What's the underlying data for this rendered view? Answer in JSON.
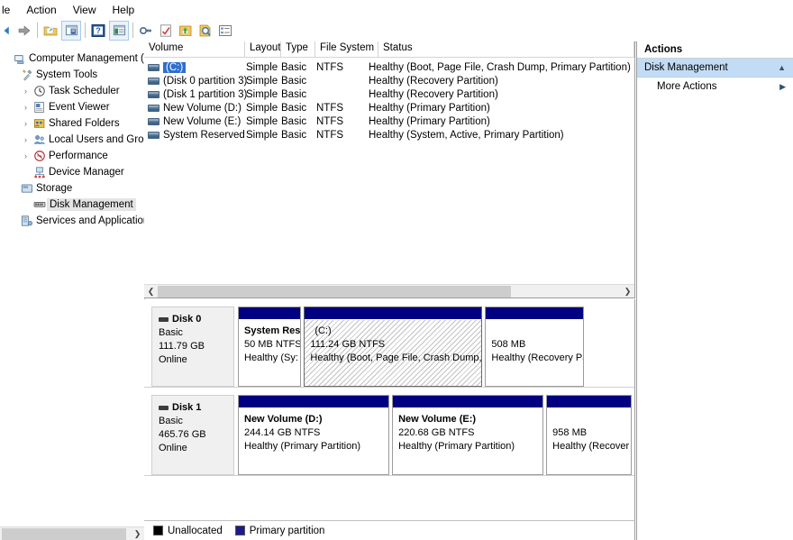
{
  "menubar": {
    "items": [
      {
        "label": "le"
      },
      {
        "label": "Action"
      },
      {
        "label": "View"
      },
      {
        "label": "Help"
      }
    ]
  },
  "toolbar": {
    "buttons": [
      {
        "name": "back-arrow-icon",
        "title": "Back"
      },
      {
        "name": "forward-arrow-icon",
        "title": "Forward"
      },
      {
        "name": "up-folder-icon",
        "title": "Up One Level"
      },
      {
        "name": "show-hide-console-tree-icon",
        "title": "Show/Hide Console Tree"
      },
      {
        "name": "help-icon",
        "title": "Help"
      },
      {
        "name": "properties-icon",
        "title": "Properties"
      },
      {
        "name": "rescan-disks-icon",
        "title": "Rescan Disks"
      },
      {
        "name": "refresh-icon",
        "title": "Refresh"
      },
      {
        "name": "export-list-icon",
        "title": "Export List"
      },
      {
        "name": "zoom-icon",
        "title": "Zoom"
      },
      {
        "name": "list-view-icon",
        "title": "View"
      }
    ]
  },
  "tree": {
    "items": [
      {
        "label": "Computer Management (Local",
        "icon": "computer-icon",
        "indent": 0,
        "expander": "",
        "selected": false
      },
      {
        "label": "System Tools",
        "icon": "tools-icon",
        "indent": 1,
        "expander": "",
        "selected": false
      },
      {
        "label": "Task Scheduler",
        "icon": "clock-icon",
        "indent": 2,
        "expander": "›",
        "selected": false
      },
      {
        "label": "Event Viewer",
        "icon": "event-viewer-icon",
        "indent": 2,
        "expander": "›",
        "selected": false
      },
      {
        "label": "Shared Folders",
        "icon": "shared-folders-icon",
        "indent": 2,
        "expander": "›",
        "selected": false
      },
      {
        "label": "Local Users and Groups",
        "icon": "users-icon",
        "indent": 2,
        "expander": "›",
        "selected": false
      },
      {
        "label": "Performance",
        "icon": "performance-icon",
        "indent": 2,
        "expander": "›",
        "selected": false
      },
      {
        "label": "Device Manager",
        "icon": "device-manager-icon",
        "indent": 2,
        "expander": "",
        "selected": false
      },
      {
        "label": "Storage",
        "icon": "storage-icon",
        "indent": 1,
        "expander": "",
        "selected": false
      },
      {
        "label": "Disk Management",
        "icon": "disk-management-icon",
        "indent": 2,
        "expander": "",
        "selected": true
      },
      {
        "label": "Services and Applications",
        "icon": "services-icon",
        "indent": 1,
        "expander": "",
        "selected": false
      }
    ]
  },
  "volume_list": {
    "headers": [
      "Volume",
      "Layout",
      "Type",
      "File System",
      "Status"
    ],
    "rows": [
      {
        "volume": "(C:)",
        "layout": "Simple",
        "type": "Basic",
        "filesystem": "NTFS",
        "status": "Healthy (Boot, Page File, Crash Dump, Primary Partition)",
        "selected": true
      },
      {
        "volume": "(Disk 0 partition 3)",
        "layout": "Simple",
        "type": "Basic",
        "filesystem": "",
        "status": "Healthy (Recovery Partition)",
        "selected": false
      },
      {
        "volume": "(Disk 1 partition 3)",
        "layout": "Simple",
        "type": "Basic",
        "filesystem": "",
        "status": "Healthy (Recovery Partition)",
        "selected": false
      },
      {
        "volume": "New Volume (D:)",
        "layout": "Simple",
        "type": "Basic",
        "filesystem": "NTFS",
        "status": "Healthy (Primary Partition)",
        "selected": false
      },
      {
        "volume": "New Volume (E:)",
        "layout": "Simple",
        "type": "Basic",
        "filesystem": "NTFS",
        "status": "Healthy (Primary Partition)",
        "selected": false
      },
      {
        "volume": "System Reserved",
        "layout": "Simple",
        "type": "Basic",
        "filesystem": "NTFS",
        "status": "Healthy (System, Active, Primary Partition)",
        "selected": false
      }
    ]
  },
  "disks": [
    {
      "name": "Disk 0",
      "type": "Basic",
      "capacity": "111.79 GB",
      "state": "Online",
      "partitions": [
        {
          "name": "System Res",
          "size": "50 MB NTFS",
          "status": "Healthy (Sy:",
          "width_pct": 16,
          "selected": false
        },
        {
          "name": "(C:)",
          "size": "111.24 GB NTFS",
          "status": "Healthy (Boot, Page File, Crash Dump, Pr",
          "width_pct": 47,
          "selected": true
        },
        {
          "name": "",
          "size": "508 MB",
          "status": "Healthy (Recovery Pa",
          "width_pct": 25,
          "selected": false
        }
      ]
    },
    {
      "name": "Disk 1",
      "type": "Basic",
      "capacity": "465.76 GB",
      "state": "Online",
      "partitions": [
        {
          "name": "New Volume  (D:)",
          "size": "244.14 GB NTFS",
          "status": "Healthy (Primary Partition)",
          "width_pct": 39,
          "selected": false
        },
        {
          "name": "New Volume  (E:)",
          "size": "220.68 GB NTFS",
          "status": "Healthy (Primary Partition)",
          "width_pct": 39,
          "selected": false
        },
        {
          "name": "",
          "size": "958 MB",
          "status": "Healthy (Recover",
          "width_pct": 22,
          "selected": false
        }
      ]
    }
  ],
  "legend": {
    "items": [
      {
        "label": "Unallocated",
        "color": "#000000"
      },
      {
        "label": "Primary partition",
        "color": "#1b1b8f"
      }
    ]
  },
  "actions": {
    "title": "Actions",
    "group_label": "Disk Management",
    "group_chevron": "▲",
    "more_actions_label": "More Actions",
    "more_actions_chevron": "▶"
  }
}
